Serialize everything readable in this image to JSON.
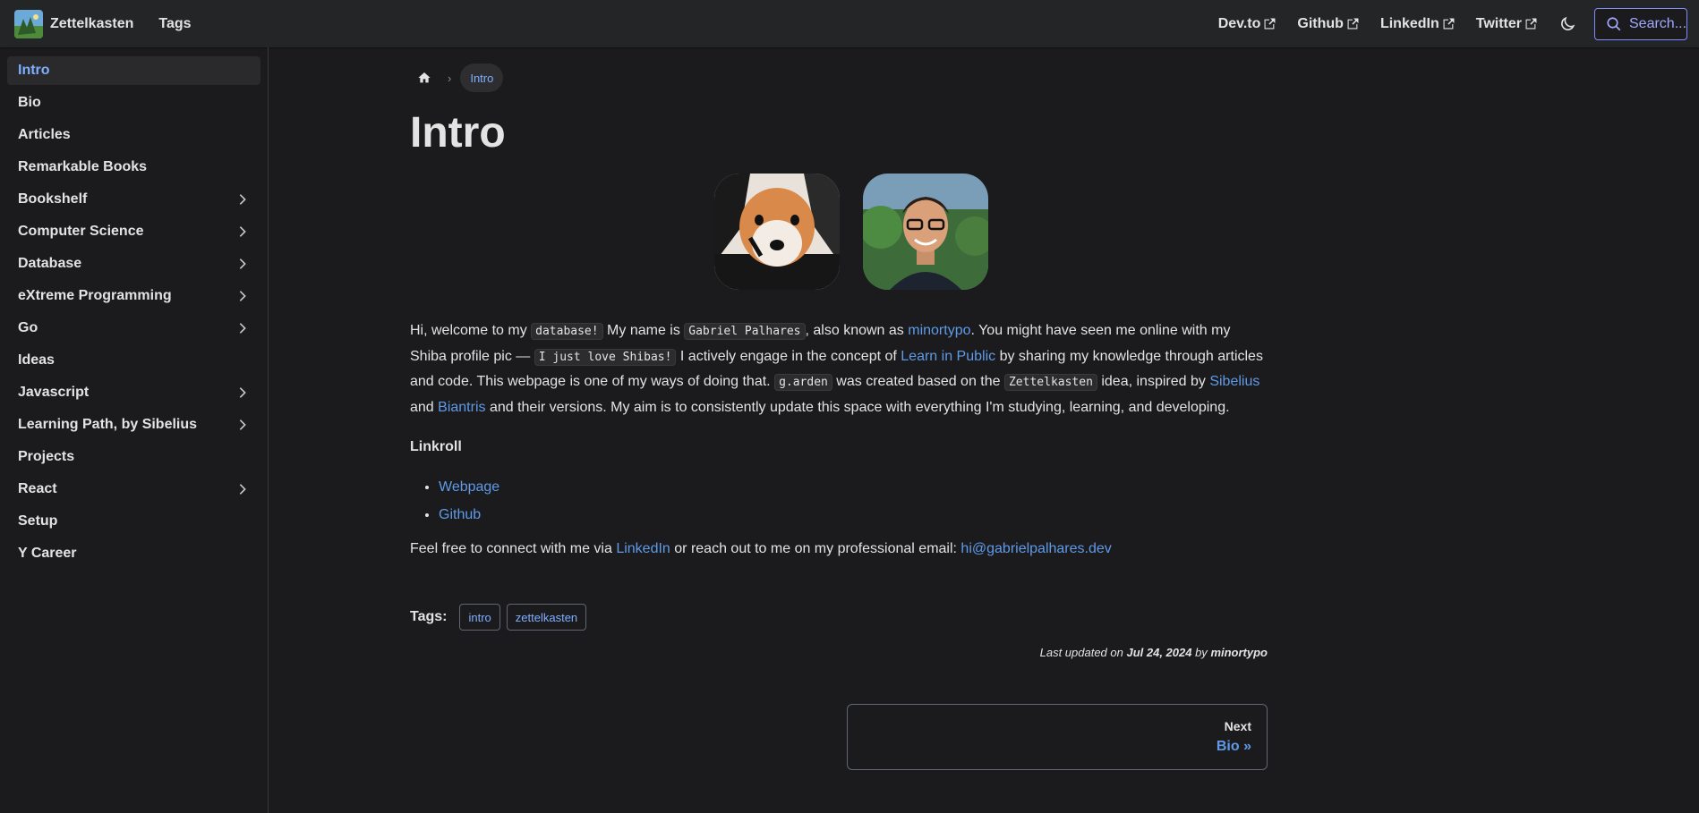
{
  "navbar": {
    "brand": "Zettelkasten",
    "tags": "Tags",
    "external_links": [
      "Dev.to",
      "Github",
      "LinkedIn",
      "Twitter"
    ],
    "search_placeholder": "Search...",
    "accent": "#7e8bff"
  },
  "sidebar": {
    "items": [
      {
        "label": "Intro",
        "expandable": false,
        "active": true
      },
      {
        "label": "Bio",
        "expandable": false
      },
      {
        "label": "Articles",
        "expandable": false
      },
      {
        "label": "Remarkable Books",
        "expandable": false
      },
      {
        "label": "Bookshelf",
        "expandable": true
      },
      {
        "label": "Computer Science",
        "expandable": true
      },
      {
        "label": "Database",
        "expandable": true
      },
      {
        "label": "eXtreme Programming",
        "expandable": true
      },
      {
        "label": "Go",
        "expandable": true
      },
      {
        "label": "Ideas",
        "expandable": false
      },
      {
        "label": "Javascript",
        "expandable": true
      },
      {
        "label": "Learning Path, by Sibelius",
        "expandable": true
      },
      {
        "label": "Projects",
        "expandable": false
      },
      {
        "label": "React",
        "expandable": true
      },
      {
        "label": "Setup",
        "expandable": false
      },
      {
        "label": "Y Career",
        "expandable": false
      }
    ]
  },
  "breadcrumb": {
    "current": "Intro"
  },
  "page": {
    "title": "Intro",
    "intro": {
      "t1": "Hi, welcome to my ",
      "c1": "database!",
      "t2": " My name is ",
      "c2": "Gabriel Palhares",
      "t3": ", also known as ",
      "l1": "minortypo",
      "t4": ". You might have seen me online with my Shiba profile pic — ",
      "c3": "I just love Shibas!",
      "t5": " I actively engage in the concept of ",
      "l2": "Learn in Public",
      "t6": " by sharing my knowledge through articles and code. This webpage is one of my ways of doing that. ",
      "c4": "g.arden",
      "t7": " was created based on the ",
      "c5": "Zettelkasten",
      "t8": " idea, inspired by ",
      "l3": "Sibelius",
      "t9": " and ",
      "l4": "Biantris",
      "t10": " and their versions. My aim is to consistently update this space with everything I'm studying, learning, and developing."
    },
    "linkroll_heading": "Linkroll",
    "linkroll": [
      "Webpage",
      "Github"
    ],
    "contact": {
      "t1": "Feel free to connect with me via ",
      "l1": "LinkedIn",
      "t2": " or reach out to me on my professional email: ",
      "l2": "hi@gabrielpalhares.dev"
    },
    "tags_label": "Tags:",
    "tags": [
      "intro",
      "zettelkasten"
    ],
    "updated": {
      "prefix": "Last updated on ",
      "date": "Jul 24, 2024",
      "by": " by ",
      "author": "minortypo"
    },
    "next": {
      "sub": "Next",
      "label": "Bio »"
    }
  },
  "colors": {
    "background": "#1b1b1d",
    "navbar": "#242526",
    "link": "#5f9ae8",
    "active": "#7eaeff"
  }
}
